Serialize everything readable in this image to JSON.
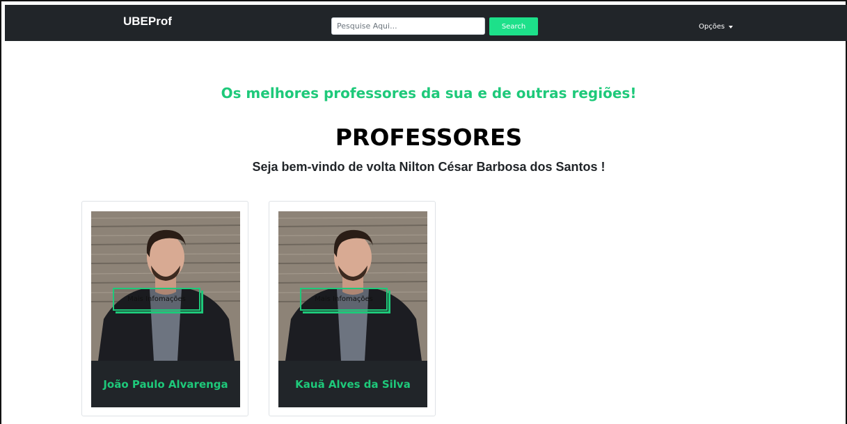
{
  "navbar": {
    "brand": "UBEProf",
    "search": {
      "placeholder": "Pesquise Aqui...",
      "value": "",
      "button_label": "Search"
    },
    "options_label": "Opções"
  },
  "hero": {
    "tagline": "Os melhores professores da sua e de outras regiões!",
    "title": "PROFESSORES",
    "welcome": "Seja bem-vindo de volta Nilton César Barbosa dos Santos !"
  },
  "cards": [
    {
      "name": "João Paulo Alvarenga",
      "button_label": "Mais Infomações"
    },
    {
      "name": "Kauã Alves da Silva",
      "button_label": "Mais Infomações"
    }
  ],
  "colors": {
    "accent": "#1ec97a",
    "navbar": "#212529",
    "search_button": "#1de08a"
  }
}
